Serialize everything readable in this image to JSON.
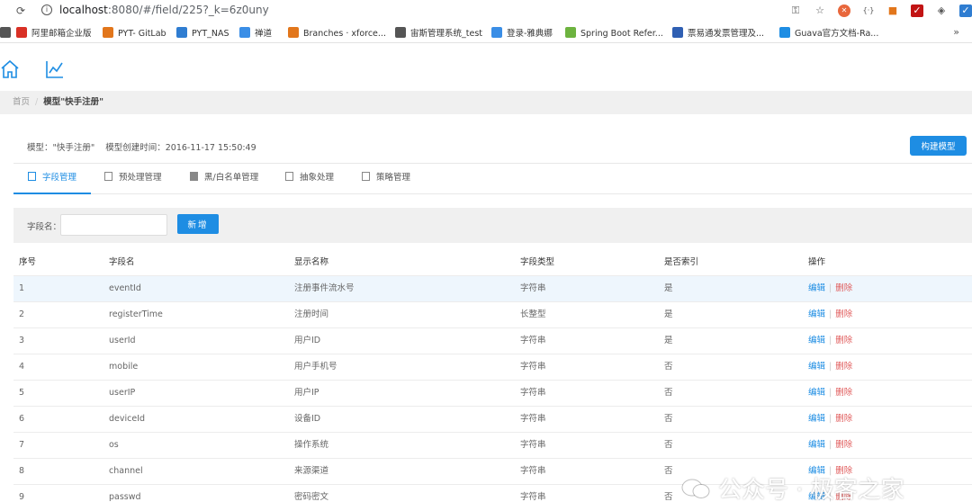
{
  "browser": {
    "url_host": "localhost",
    "url_rest": ":8080/#/field/225?_k=6z0uny"
  },
  "bookmarks": [
    {
      "label": "",
      "icon": "apps-icon"
    },
    {
      "label": "阿里邮箱企业版",
      "icon": "mail-icon",
      "color": "#d93025"
    },
    {
      "label": "PYT- GitLab",
      "icon": "gitlab-icon",
      "color": "#e2761b"
    },
    {
      "label": "PYT_NAS",
      "icon": "nas-icon",
      "color": "#2f7dd1"
    },
    {
      "label": "禅道",
      "icon": "zentao-icon",
      "color": "#3a8ee6"
    },
    {
      "label": "Branches · xforce...",
      "icon": "gitlab-icon",
      "color": "#e2761b"
    },
    {
      "label": "宙斯管理系统_test",
      "icon": "globe-icon",
      "color": "#555555"
    },
    {
      "label": "登录-雅典娜",
      "icon": "bird-icon",
      "color": "#3a8ee6"
    },
    {
      "label": "Spring Boot Refer...",
      "icon": "spring-icon",
      "color": "#6db33f"
    },
    {
      "label": "票易通发票管理及...",
      "icon": "w-icon",
      "color": "#2f5fb3"
    },
    {
      "label": "Guava官方文档-Ra...",
      "icon": "guava-icon",
      "color": "#1e8de3"
    }
  ],
  "breadcrumb": {
    "home": "首页",
    "current": "模型\"快手注册\""
  },
  "model": {
    "name": "模型：\"快手注册\"",
    "created": "模型创建时间：2016-11-17 15:50:49",
    "build_label": "构建模型"
  },
  "tabs": [
    {
      "label": "字段管理",
      "active": true
    },
    {
      "label": "预处理管理",
      "active": false
    },
    {
      "label": "黑/白名单管理",
      "active": false
    },
    {
      "label": "抽象处理",
      "active": false
    },
    {
      "label": "策略管理",
      "active": false
    }
  ],
  "filter": {
    "label": "字段名：",
    "value": "",
    "add_label": "新增"
  },
  "table": {
    "headers": [
      "序号",
      "字段名",
      "显示名称",
      "字段类型",
      "是否索引",
      "操作"
    ],
    "edit_label": "编辑",
    "sep": "|",
    "delete_label": "删除",
    "rows": [
      [
        "1",
        "eventId",
        "注册事件流水号",
        "字符串",
        "是"
      ],
      [
        "2",
        "registerTime",
        "注册时间",
        "长整型",
        "是"
      ],
      [
        "3",
        "userId",
        "用户ID",
        "字符串",
        "是"
      ],
      [
        "4",
        "mobile",
        "用户手机号",
        "字符串",
        "否"
      ],
      [
        "5",
        "userIP",
        "用户IP",
        "字符串",
        "否"
      ],
      [
        "6",
        "deviceId",
        "设备ID",
        "字符串",
        "否"
      ],
      [
        "7",
        "os",
        "操作系统",
        "字符串",
        "否"
      ],
      [
        "8",
        "channel",
        "来源渠道",
        "字符串",
        "否"
      ],
      [
        "9",
        "passwd",
        "密码密文",
        "字符串",
        "否"
      ]
    ]
  },
  "watermark": "公众号 · 极客之家",
  "colors": {
    "accent": "#1e8de3",
    "danger": "#e05a5a"
  }
}
